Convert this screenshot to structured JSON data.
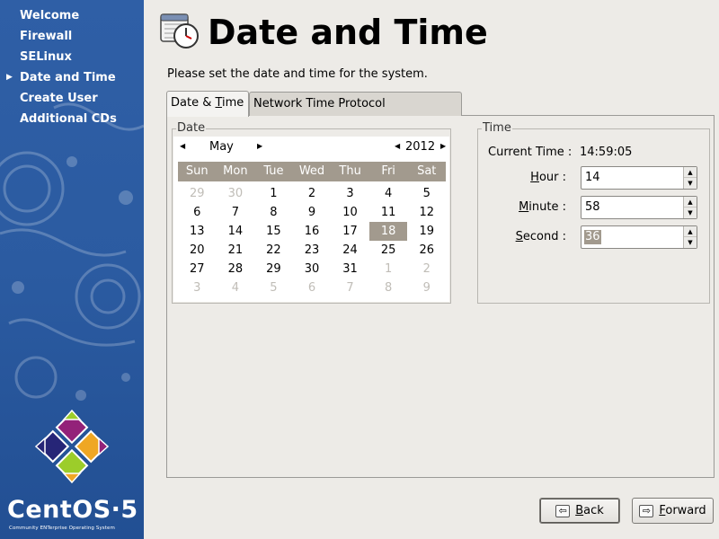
{
  "sidebar": {
    "current_step_index": 3,
    "steps": [
      {
        "label": "Welcome"
      },
      {
        "label": "Firewall"
      },
      {
        "label": "SELinux"
      },
      {
        "label": "Date and Time"
      },
      {
        "label": "Create User"
      },
      {
        "label": "Additional CDs"
      }
    ],
    "logo": {
      "name": "CentOS·5",
      "tagline": "Community ENTerprise Operating System",
      "colors": [
        "#9ccd2a",
        "#932279",
        "#efa724",
        "#262577"
      ]
    }
  },
  "header": {
    "icon": "calendar-clock-icon",
    "title": "Date and Time"
  },
  "instruction": "Please set the date and time for the system.",
  "tabs": [
    {
      "label_pre": "Date & ",
      "label_mnemonic": "T",
      "label_post": "ime",
      "active": true
    },
    {
      "label_pre": "Network Time Protocol",
      "active": false
    }
  ],
  "date_section": {
    "label": "Date",
    "calendar": {
      "month": "May",
      "year": "2012",
      "weekdays": [
        "Sun",
        "Mon",
        "Tue",
        "Wed",
        "Thu",
        "Fri",
        "Sat"
      ],
      "selected_day": "18",
      "weeks": [
        [
          "29",
          "30",
          "1",
          "2",
          "3",
          "4",
          "5"
        ],
        [
          "6",
          "7",
          "8",
          "9",
          "10",
          "11",
          "12"
        ],
        [
          "13",
          "14",
          "15",
          "16",
          "17",
          "18",
          "19"
        ],
        [
          "20",
          "21",
          "22",
          "23",
          "24",
          "25",
          "26"
        ],
        [
          "27",
          "28",
          "29",
          "30",
          "31",
          "1",
          "2"
        ],
        [
          "3",
          "4",
          "5",
          "6",
          "7",
          "8",
          "9"
        ]
      ],
      "other_month_mask": [
        [
          true,
          true,
          false,
          false,
          false,
          false,
          false
        ],
        [
          false,
          false,
          false,
          false,
          false,
          false,
          false
        ],
        [
          false,
          false,
          false,
          false,
          false,
          false,
          false
        ],
        [
          false,
          false,
          false,
          false,
          false,
          false,
          false
        ],
        [
          false,
          false,
          false,
          false,
          false,
          true,
          true
        ],
        [
          true,
          true,
          true,
          true,
          true,
          true,
          true
        ]
      ]
    }
  },
  "time_section": {
    "label": "Time",
    "current_time_label": "Current Time :",
    "current_time_value": "14:59:05",
    "hour": {
      "mnemonic": "H",
      "rest": "our :",
      "value": "14"
    },
    "minute": {
      "mnemonic": "M",
      "rest": "inute :",
      "value": "58"
    },
    "second": {
      "mnemonic": "S",
      "rest": "econd :",
      "value": "36"
    }
  },
  "buttons": {
    "back": {
      "mnemonic": "B",
      "rest": "ack"
    },
    "forward": {
      "mnemonic": "F",
      "rest": "orward"
    }
  }
}
